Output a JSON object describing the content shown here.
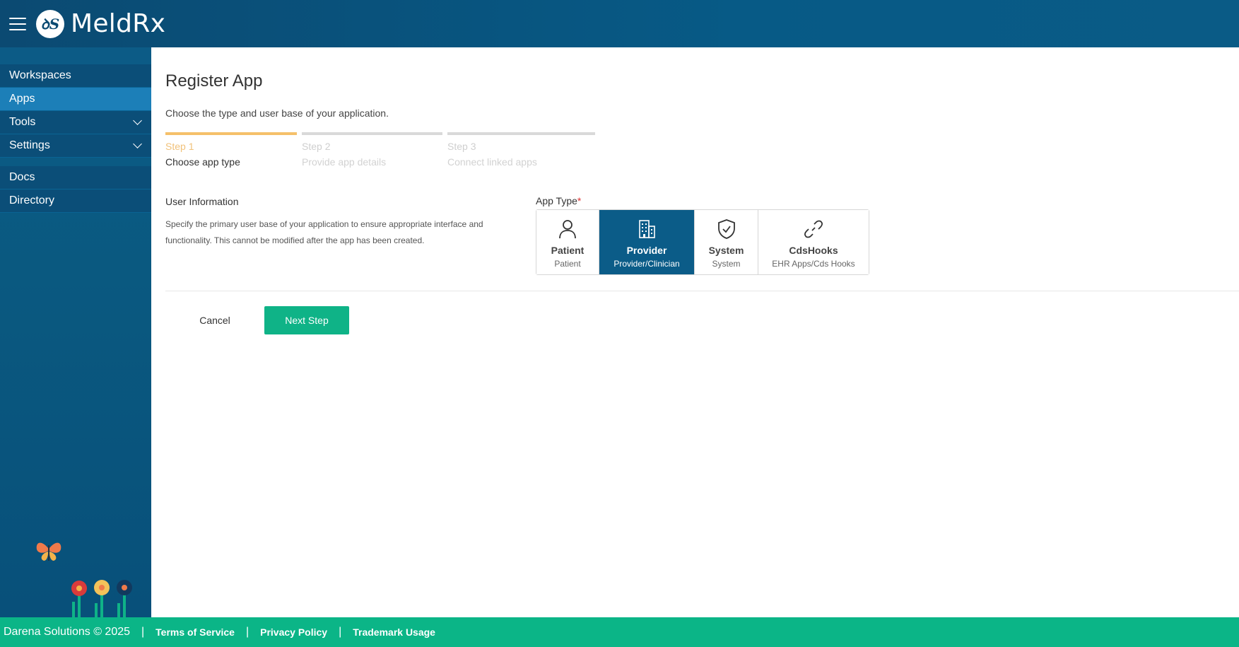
{
  "header": {
    "brand": "MeldRx",
    "logo_text": "ꝺS",
    "menu_icon": "hamburger-icon"
  },
  "sidebar": {
    "group1": [
      {
        "label": "Workspaces",
        "active": false,
        "expandable": false
      },
      {
        "label": "Apps",
        "active": true,
        "expandable": false
      },
      {
        "label": "Tools",
        "active": false,
        "expandable": true
      },
      {
        "label": "Settings",
        "active": false,
        "expandable": true
      }
    ],
    "group2": [
      {
        "label": "Docs"
      },
      {
        "label": "Directory"
      }
    ]
  },
  "main": {
    "title": "Register App",
    "subtitle": "Choose the type and user base of your application.",
    "steps": [
      {
        "num": "Step 1",
        "label": "Choose app type",
        "active": true
      },
      {
        "num": "Step 2",
        "label": "Provide app details",
        "active": false
      },
      {
        "num": "Step 3",
        "label": "Connect linked apps",
        "active": false
      }
    ],
    "user_info": {
      "title": "User Information",
      "description": "Specify the primary user base of your application to ensure appropriate interface and functionality. This cannot be modified after the app has been created."
    },
    "app_type": {
      "label": "App Type",
      "required_mark": "*",
      "options": [
        {
          "name": "Patient",
          "sub": "Patient",
          "icon": "person-icon",
          "selected": false
        },
        {
          "name": "Provider",
          "sub": "Provider/Clinician",
          "icon": "building-icon",
          "selected": true
        },
        {
          "name": "System",
          "sub": "System",
          "icon": "shield-check-icon",
          "selected": false
        },
        {
          "name": "CdsHooks",
          "sub": "EHR Apps/Cds Hooks",
          "icon": "link-icon",
          "selected": false
        }
      ]
    },
    "buttons": {
      "cancel": "Cancel",
      "next": "Next Step"
    }
  },
  "footer": {
    "copyright": "Darena Solutions © 2025",
    "separator": "|",
    "links": [
      "Terms of Service",
      "Privacy Policy",
      "Trademark Usage"
    ]
  },
  "colors": {
    "header": "#0b4a72",
    "accent": "#0fb387",
    "selected": "#0b5c88",
    "step_active": "#f5c06a"
  }
}
